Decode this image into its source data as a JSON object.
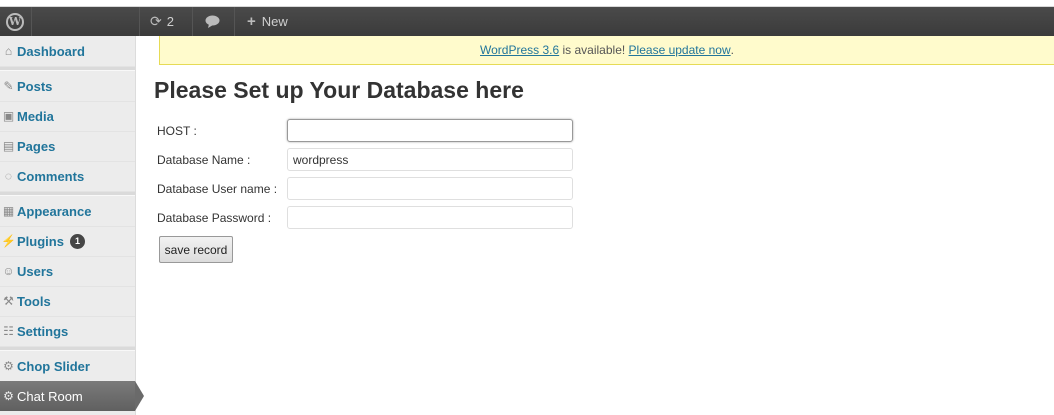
{
  "admin_bar": {
    "logo_icon": "wordpress-logo-icon",
    "updates_count": "2",
    "new_label": "New"
  },
  "notice": {
    "version_link": "WordPress 3.6",
    "middle_text": " is available! ",
    "update_link": "Please update now",
    "end_text": "."
  },
  "sidebar": {
    "items": [
      {
        "label": "Dashboard",
        "icon": "dashboard-icon"
      },
      {
        "label": "Posts",
        "icon": "pin-icon"
      },
      {
        "label": "Media",
        "icon": "media-icon"
      },
      {
        "label": "Pages",
        "icon": "pages-icon"
      },
      {
        "label": "Comments",
        "icon": "comment-icon"
      },
      {
        "label": "Appearance",
        "icon": "appearance-icon"
      },
      {
        "label": "Plugins",
        "icon": "plugin-icon",
        "badge": "1"
      },
      {
        "label": "Users",
        "icon": "users-icon"
      },
      {
        "label": "Tools",
        "icon": "tools-icon"
      },
      {
        "label": "Settings",
        "icon": "settings-icon"
      },
      {
        "label": "Chop Slider",
        "icon": "gear-icon"
      },
      {
        "label": "Chat Room",
        "icon": "gear-icon",
        "active": true
      }
    ]
  },
  "form": {
    "title": "Please Set up Your Database here",
    "host_label": "HOST :",
    "host_value": "",
    "dbname_label": "Database Name :",
    "dbname_value": "wordpress",
    "dbuser_label": "Database User name :",
    "dbuser_value": "",
    "dbpass_label": "Database Password :",
    "dbpass_value": "",
    "save_label": "save record"
  },
  "colors": {
    "admin_bar": "#464646",
    "link": "#21759b",
    "notice_bg": "#fffbcc",
    "notice_border": "#e6db55"
  }
}
